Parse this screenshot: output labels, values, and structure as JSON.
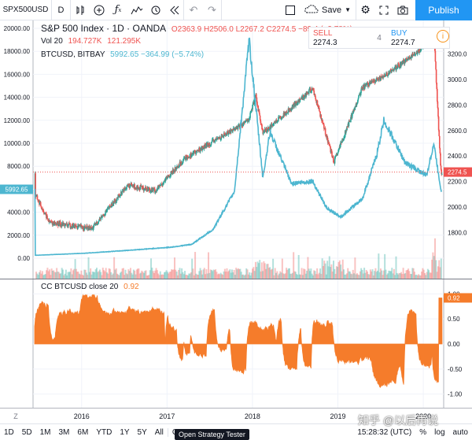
{
  "toolbar": {
    "symbol": "SPX500USD",
    "interval": "D",
    "save_label": "Save",
    "publish_label": "Publish",
    "icons": [
      "compare-icon",
      "add-indicator-icon",
      "fx-icon",
      "chart-style-icon",
      "alert-icon",
      "replay-icon",
      "undo-icon",
      "redo-icon",
      "layout-icon",
      "cloud-icon",
      "settings-icon",
      "fullscreen-icon",
      "camera-icon"
    ]
  },
  "main_legend": {
    "title": "S&P 500 Index · 1D · OANDA",
    "ohlc": "O2363.9 H2506.0 L2267.2 C2274.5 −89.4 (−3.78%)",
    "vol_label": "Vol 20",
    "vol_value1": "194.727K",
    "vol_value2": "121.295K",
    "btc_label": "BTCUSD, BITBAY",
    "btc_value": "5992.65 −364.99 (−5.74%)"
  },
  "trade_panel": {
    "sell_label": "SELL",
    "sell_price": "2274.3",
    "spread": "4",
    "buy_label": "BUY",
    "buy_price": "2274.7"
  },
  "colors": {
    "btc_line": "#4db6d0",
    "up": "#26a69a",
    "down": "#ef5350",
    "price_tag": "#ef5350",
    "cc_fill": "#f57c2b"
  },
  "left_axis": [
    "20000.00",
    "18000.00",
    "16000.00",
    "14000.00",
    "12000.00",
    "10000.00",
    "8000.00",
    "6000.00",
    "4000.00",
    "2000.00",
    "0.00"
  ],
  "right_axis": [
    "3200.0",
    "3000.0",
    "2800.0",
    "2600.0",
    "2400.0",
    "2200.0",
    "2000.0",
    "1800.0"
  ],
  "price_tags": {
    "btc": "5992.65",
    "spx": "2274.5"
  },
  "cc_legend": {
    "label": "CC BTCUSD close 20",
    "value": "0.92"
  },
  "cc_axis": [
    "1.00",
    "0.50",
    "0.00",
    "-0.50",
    "-1.00"
  ],
  "time_axis": [
    "2016",
    "2017",
    "2018",
    "2019",
    "2020"
  ],
  "bottom_bar": {
    "ranges": [
      "1D",
      "5D",
      "1M",
      "3M",
      "6M",
      "YTD",
      "1Y",
      "5Y",
      "All"
    ],
    "goto": "Go",
    "tooltip": "Open Strategy Tester",
    "clock": "15:28:32 (UTC)",
    "percent": "%",
    "log": "log",
    "auto": "auto"
  },
  "watermark": "知乎 @以后再说",
  "chart_data": [
    {
      "type": "line",
      "title": "S&P 500 Index · 1D · OANDA",
      "series": [
        {
          "name": "BTCUSD, BITBAY",
          "x": [
            "2015-06",
            "2016-01",
            "2016-07",
            "2017-01",
            "2017-04",
            "2017-07",
            "2017-10",
            "2017-12-17",
            "2018-02",
            "2018-03",
            "2018-06",
            "2018-09",
            "2018-11",
            "2019-01",
            "2019-04",
            "2019-06",
            "2019-07",
            "2019-10",
            "2020-01",
            "2020-02",
            "2020-03"
          ],
          "values": [
            250,
            430,
            680,
            950,
            1200,
            2500,
            5800,
            19000,
            7000,
            11000,
            6500,
            6700,
            4300,
            3600,
            5200,
            9000,
            12000,
            8300,
            7200,
            10000,
            5992.65
          ]
        },
        {
          "name": "S&P 500",
          "x": [
            "2015-06",
            "2015-08",
            "2016-02",
            "2016-07",
            "2016-11",
            "2017-03",
            "2017-12",
            "2018-01",
            "2018-02",
            "2018-09",
            "2018-12",
            "2019-04",
            "2019-07",
            "2019-12",
            "2020-02",
            "2020-03"
          ],
          "values": [
            2100,
            1880,
            1830,
            2170,
            2130,
            2380,
            2680,
            2870,
            2580,
            2930,
            2350,
            2940,
            3020,
            3230,
            3390,
            2274.5
          ]
        }
      ],
      "left_ylim": [
        0,
        20000
      ],
      "right_ylim": [
        1600,
        3400
      ]
    },
    {
      "type": "area",
      "title": "CC BTCUSD close 20",
      "ylim": [
        -1.1,
        1.1
      ],
      "last_value": 0.92
    }
  ]
}
